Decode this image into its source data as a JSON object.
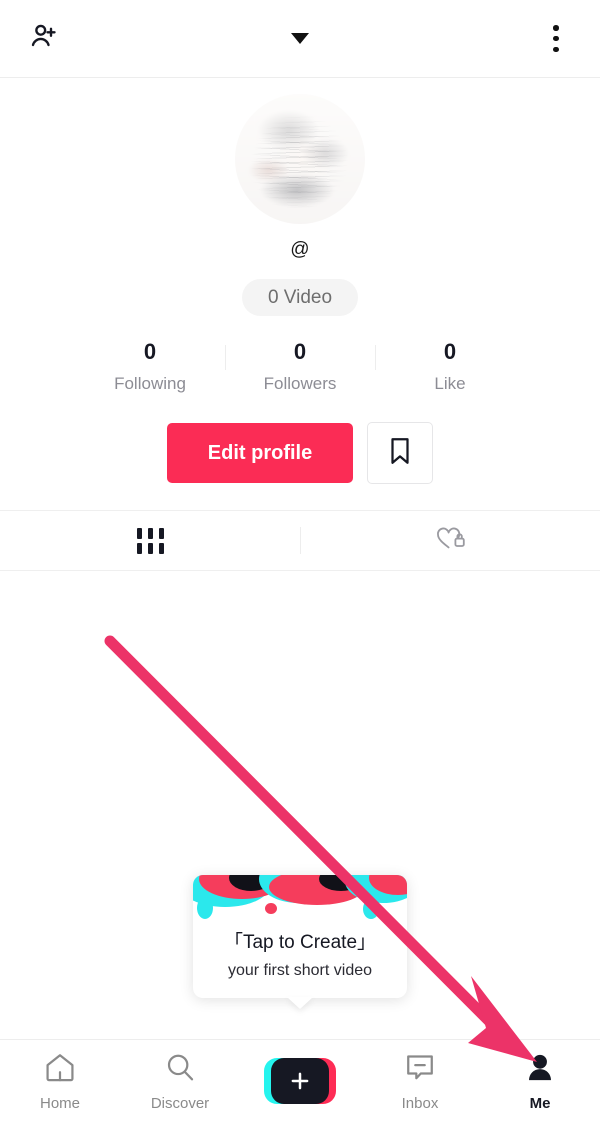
{
  "app": {
    "name": "TikTok",
    "screen": "Profile"
  },
  "header": {
    "add_friends_icon": "person-add-icon",
    "dropdown_icon": "chevron-down-icon",
    "more_icon": "three-dot-menu-icon"
  },
  "profile": {
    "avatar_state": "blurred-redacted-photo",
    "handle": "@",
    "video_badge": "0 Video",
    "stats": [
      {
        "value": "0",
        "label": "Following"
      },
      {
        "value": "0",
        "label": "Followers"
      },
      {
        "value": "0",
        "label": "Like"
      }
    ],
    "edit_profile_label": "Edit profile",
    "bookmark_icon": "bookmark-icon"
  },
  "tabs": [
    {
      "icon": "grid-icon",
      "active": true
    },
    {
      "icon": "locked-heart-icon",
      "active": false
    }
  ],
  "create_tooltip": {
    "title": "「Tap to Create」",
    "subtitle": "your first short video"
  },
  "bottom_nav": [
    {
      "label": "Home",
      "icon": "home-icon",
      "active": false
    },
    {
      "label": "Discover",
      "icon": "search-icon",
      "active": false
    },
    {
      "label": "",
      "icon": "create-plus-icon",
      "active": false
    },
    {
      "label": "Inbox",
      "icon": "inbox-message-icon",
      "active": false
    },
    {
      "label": "Me",
      "icon": "person-icon",
      "active": true
    }
  ],
  "annotation": {
    "type": "arrow",
    "points_to": "Me tab",
    "color": "#ec3368"
  },
  "colors": {
    "brand_red": "#fb2c55",
    "brand_cyan": "#25f4ee",
    "ink": "#161823",
    "muted": "#8c8c94",
    "arrow": "#ec3368"
  }
}
